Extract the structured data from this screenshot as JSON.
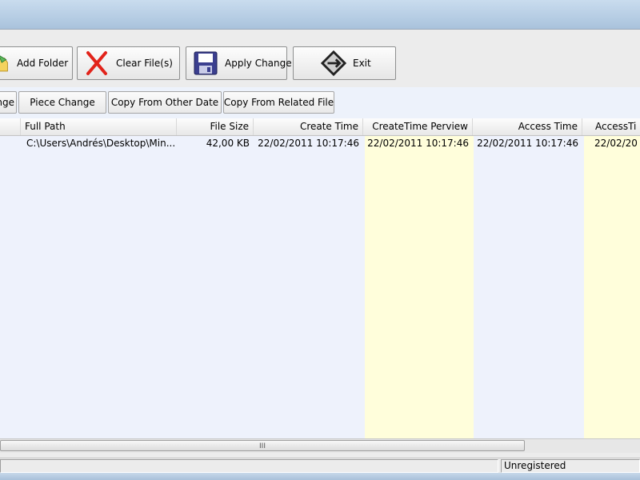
{
  "toolbar": {
    "add_folder": "Add Folder",
    "clear_files": "Clear File(s)",
    "apply_change": "Apply Change",
    "exit": "Exit"
  },
  "subbar": {
    "partial_tab": "nge",
    "piece_change": "Piece Change",
    "copy_other_date": "Copy From Other Date",
    "copy_related_file": "Copy From Related File"
  },
  "grid": {
    "columns": [
      "Full Path",
      "File Size",
      "Create Time",
      "CreateTime Perview",
      "Access Time",
      "AccessTi"
    ],
    "rows": [
      {
        "full_path": "C:\\Users\\Andrés\\Desktop\\Min...",
        "file_size": "42,00 KB",
        "create_time": "22/02/2011 10:17:46",
        "create_preview": "22/02/2011 10:17:46",
        "access_time": "22/02/2011 10:17:46",
        "access_preview": "22/02/20"
      }
    ],
    "highlight_color": "#fffedb"
  },
  "scrollbar": {
    "grip": "III"
  },
  "status": {
    "registration": "Unregistered"
  },
  "icons": {
    "add_folder": "folder-add-icon",
    "clear_files": "red-x-icon",
    "apply_change": "floppy-disk-icon",
    "exit": "exit-diamond-icon"
  }
}
